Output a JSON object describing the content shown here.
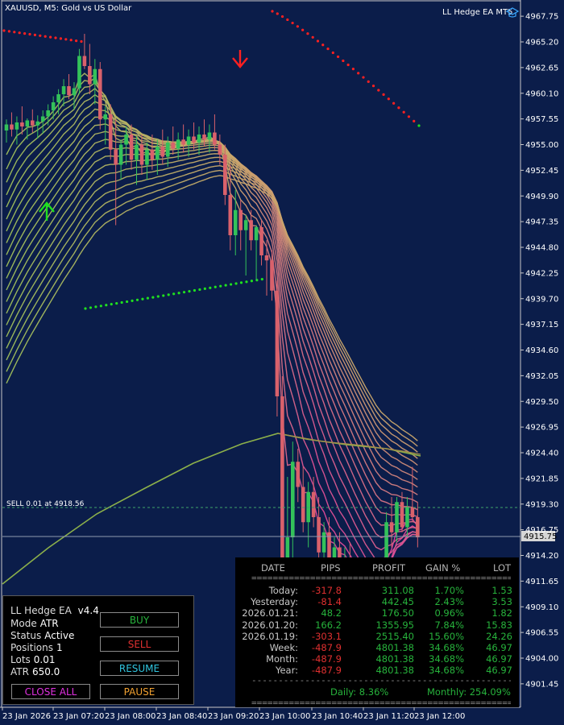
{
  "window": {
    "title": "XAUUSD, M5:  Gold vs US Dollar",
    "ea_badge": "LL Hedge EA MT5"
  },
  "chart_data": {
    "type": "candlestick",
    "symbol": "XAUUSD",
    "timeframe": "M5",
    "description": "Gold vs US Dollar",
    "ylim": [
      4899.2,
      4969.2
    ],
    "y_ticks": [
      4967.75,
      4965.2,
      4962.65,
      4960.1,
      4957.55,
      4955.0,
      4952.45,
      4949.9,
      4947.35,
      4944.8,
      4942.25,
      4939.7,
      4937.15,
      4934.6,
      4932.05,
      4929.5,
      4926.95,
      4924.4,
      4921.85,
      4919.3,
      4916.75,
      4914.2,
      4911.65,
      4909.1,
      4906.55,
      4904.0,
      4901.45
    ],
    "x_ticks": [
      "23 Jan 2026",
      "23 Jan 07:20",
      "23 Jan 08:00",
      "23 Jan 08:40",
      "23 Jan 09:20",
      "23 Jan 10:00",
      "23 Jan 10:40",
      "23 Jan 11:20",
      "23 Jan 12:00"
    ],
    "current_price": "4915.75",
    "position_line": {
      "label": "SELL 0.01 at 4918.56",
      "price": 4918.56
    },
    "candles": [
      [
        4956.4,
        4957.5,
        4955.2,
        4957.0
      ],
      [
        4957.0,
        4958.2,
        4955.8,
        4956.5
      ],
      [
        4956.5,
        4957.8,
        4955.0,
        4957.2
      ],
      [
        4957.2,
        4958.8,
        4956.0,
        4956.8
      ],
      [
        4956.8,
        4957.6,
        4955.5,
        4957.4
      ],
      [
        4957.4,
        4958.5,
        4956.2,
        4956.9
      ],
      [
        4956.9,
        4957.9,
        4955.6,
        4957.3
      ],
      [
        4957.3,
        4958.4,
        4956.1,
        4957.8
      ],
      [
        4957.8,
        4959.0,
        4956.9,
        4958.4
      ],
      [
        4958.4,
        4959.8,
        4957.5,
        4959.2
      ],
      [
        4959.2,
        4960.5,
        4958.0,
        4960.0
      ],
      [
        4960.0,
        4961.5,
        4958.8,
        4960.8
      ],
      [
        4960.8,
        4962.0,
        4959.5,
        4959.9
      ],
      [
        4959.9,
        4961.2,
        4958.5,
        4960.6
      ],
      [
        4960.6,
        4964.5,
        4960.0,
        4963.8
      ],
      [
        4963.8,
        4966.0,
        4962.5,
        4962.8
      ],
      [
        4962.8,
        4965.0,
        4960.0,
        4961.0
      ],
      [
        4961.0,
        4963.5,
        4959.0,
        4962.5
      ],
      [
        4962.5,
        4963.2,
        4956.5,
        4957.5
      ],
      [
        4957.5,
        4958.8,
        4955.0,
        4958.0
      ],
      [
        4958.0,
        4959.0,
        4953.5,
        4954.5
      ],
      [
        4954.5,
        4957.5,
        4947.0,
        4953.0
      ],
      [
        4953.0,
        4955.5,
        4951.5,
        4955.0
      ],
      [
        4955.0,
        4956.8,
        4953.0,
        4956.0
      ],
      [
        4956.0,
        4957.0,
        4952.5,
        4953.5
      ],
      [
        4953.5,
        4955.8,
        4951.0,
        4955.0
      ],
      [
        4955.0,
        4956.0,
        4952.0,
        4953.0
      ],
      [
        4953.0,
        4955.2,
        4951.5,
        4954.5
      ],
      [
        4954.5,
        4956.0,
        4952.5,
        4953.5
      ],
      [
        4953.5,
        4955.5,
        4952.0,
        4954.8
      ],
      [
        4954.8,
        4956.5,
        4953.0,
        4953.8
      ],
      [
        4953.8,
        4955.8,
        4952.8,
        4955.2
      ],
      [
        4955.2,
        4956.8,
        4954.0,
        4954.6
      ],
      [
        4954.6,
        4956.2,
        4953.5,
        4955.5
      ],
      [
        4955.5,
        4957.0,
        4954.2,
        4955.0
      ],
      [
        4955.0,
        4956.5,
        4953.8,
        4955.8
      ],
      [
        4955.8,
        4957.2,
        4954.5,
        4955.2
      ],
      [
        4955.2,
        4956.8,
        4954.0,
        4956.0
      ],
      [
        4956.0,
        4957.5,
        4954.8,
        4955.5
      ],
      [
        4955.5,
        4957.0,
        4954.2,
        4956.2
      ],
      [
        4956.2,
        4958.0,
        4954.5,
        4955.0
      ],
      [
        4955.0,
        4956.0,
        4953.0,
        4954.0
      ],
      [
        4954.0,
        4955.0,
        4949.0,
        4950.0
      ],
      [
        4950.0,
        4953.0,
        4944.5,
        4946.0
      ],
      [
        4946.0,
        4950.5,
        4944.0,
        4948.5
      ],
      [
        4948.5,
        4949.5,
        4944.5,
        4946.5
      ],
      [
        4946.5,
        4948.0,
        4942.0,
        4947.5
      ],
      [
        4947.5,
        4948.5,
        4944.5,
        4945.5
      ],
      [
        4945.5,
        4947.0,
        4941.5,
        4946.8
      ],
      [
        4946.8,
        4947.5,
        4943.0,
        4944.0
      ],
      [
        4944.0,
        4945.5,
        4940.0,
        4943.5
      ],
      [
        4943.5,
        4944.5,
        4939.5,
        4940.5
      ],
      [
        4940.5,
        4941.5,
        4928.0,
        4930.0
      ],
      [
        4930.0,
        4932.0,
        4911.0,
        4913.0
      ],
      [
        4913.0,
        4922.0,
        4911.5,
        4916.0
      ],
      [
        4916.0,
        4925.5,
        4914.0,
        4923.5
      ],
      [
        4923.5,
        4924.8,
        4919.5,
        4921.0
      ],
      [
        4921.0,
        4923.0,
        4916.5,
        4917.5
      ],
      [
        4917.5,
        4921.5,
        4915.0,
        4920.5
      ],
      [
        4920.5,
        4922.0,
        4917.0,
        4918.0
      ],
      [
        4918.0,
        4920.0,
        4913.0,
        4914.5
      ],
      [
        4914.5,
        4917.5,
        4912.0,
        4916.5
      ],
      [
        4916.5,
        4918.0,
        4912.5,
        4913.5
      ],
      [
        4913.5,
        4916.0,
        4911.0,
        4915.0
      ],
      [
        4915.0,
        4916.5,
        4912.0,
        4913.0
      ],
      [
        4913.0,
        4915.0,
        4910.5,
        4914.0
      ],
      [
        4914.0,
        4915.5,
        4911.0,
        4912.0
      ],
      [
        4912.0,
        4913.5,
        4909.5,
        4911.0
      ],
      [
        4911.0,
        4912.5,
        4909.0,
        4910.5
      ],
      [
        4910.5,
        4912.0,
        4908.5,
        4909.5
      ],
      [
        4909.5,
        4911.0,
        4907.5,
        4910.0
      ],
      [
        4910.0,
        4911.5,
        4908.0,
        4909.0
      ],
      [
        4909.0,
        4913.5,
        4908.5,
        4913.0
      ],
      [
        4913.0,
        4918.5,
        4912.0,
        4917.5
      ],
      [
        4917.5,
        4920.0,
        4915.0,
        4916.5
      ],
      [
        4916.5,
        4920.0,
        4915.5,
        4919.5
      ],
      [
        4919.5,
        4920.5,
        4916.5,
        4917.0
      ],
      [
        4917.0,
        4920.0,
        4916.0,
        4919.0
      ],
      [
        4919.0,
        4923.0,
        4917.5,
        4918.0
      ],
      [
        4918.0,
        4919.5,
        4915.0,
        4916.0
      ]
    ],
    "sell_arrow": {
      "candle": 47,
      "price": 4964.0
    },
    "buy_arrow": {
      "candle": 9,
      "price": 4947.0
    },
    "ribbon": {
      "fast_ma_period": 8,
      "slow_ma_period": 180,
      "bands": 20
    }
  },
  "ea_panel": {
    "title_label": "LL Hedge EA",
    "version": "v4.4",
    "rows": [
      {
        "label": "Mode",
        "value": "ATR"
      },
      {
        "label": "Status",
        "value": "Active"
      },
      {
        "label": "Positions",
        "value": "1"
      },
      {
        "label": "Lots",
        "value": "0.01"
      },
      {
        "label": "ATR",
        "value": "650.0"
      }
    ],
    "buttons": {
      "buy": "BUY",
      "sell": "SELL",
      "resume": "RESUME",
      "close_all": "CLOSE ALL",
      "pause": "PAUSE"
    },
    "colors": {
      "buy": "#27b33c",
      "sell": "#e03030",
      "resume": "#30c6e0",
      "close_all": "#e030e0",
      "pause": "#f0a030"
    }
  },
  "stats": {
    "headers": [
      "DATE",
      "PIPS",
      "PROFIT",
      "GAIN %",
      "LOT"
    ],
    "separator": "=============================================================",
    "separator2": "--------------------------------------------------------------------",
    "rows": [
      {
        "label": "Today:",
        "pips": "-317.8",
        "profit": "311.08",
        "gain": "1.70%",
        "lot": "1.53"
      },
      {
        "label": "Yesterday:",
        "pips": "-81.4",
        "profit": "442.45",
        "gain": "2.43%",
        "lot": "3.53"
      },
      {
        "label": "2026.01.21:",
        "pips": "48.2",
        "profit": "176.50",
        "gain": "0.96%",
        "lot": "1.82"
      },
      {
        "label": "2026.01.20:",
        "pips": "166.2",
        "profit": "1355.95",
        "gain": "7.84%",
        "lot": "15.83"
      },
      {
        "label": "2026.01.19:",
        "pips": "-303.1",
        "profit": "2515.40",
        "gain": "15.60%",
        "lot": "24.26"
      },
      {
        "label": "Week:",
        "pips": "-487.9",
        "profit": "4801.38",
        "gain": "34.68%",
        "lot": "46.97"
      },
      {
        "label": "Month:",
        "pips": "-487.9",
        "profit": "4801.38",
        "gain": "34.68%",
        "lot": "46.97"
      },
      {
        "label": "Year:",
        "pips": "-487.9",
        "profit": "4801.38",
        "gain": "34.68%",
        "lot": "46.97"
      }
    ],
    "daily": "Daily: 8.36%",
    "monthly": "Monthly: 254.09%"
  },
  "colors": {
    "background": "#0b1d4a",
    "bull": "#33c25a",
    "bear": "#d9616b",
    "grid_dash": "#3fa36b",
    "price_line": "#8f9bb0",
    "dots_buy": "#1fe01f",
    "dots_sell": "#ff2020",
    "slow_ma": "#8cb04a"
  }
}
